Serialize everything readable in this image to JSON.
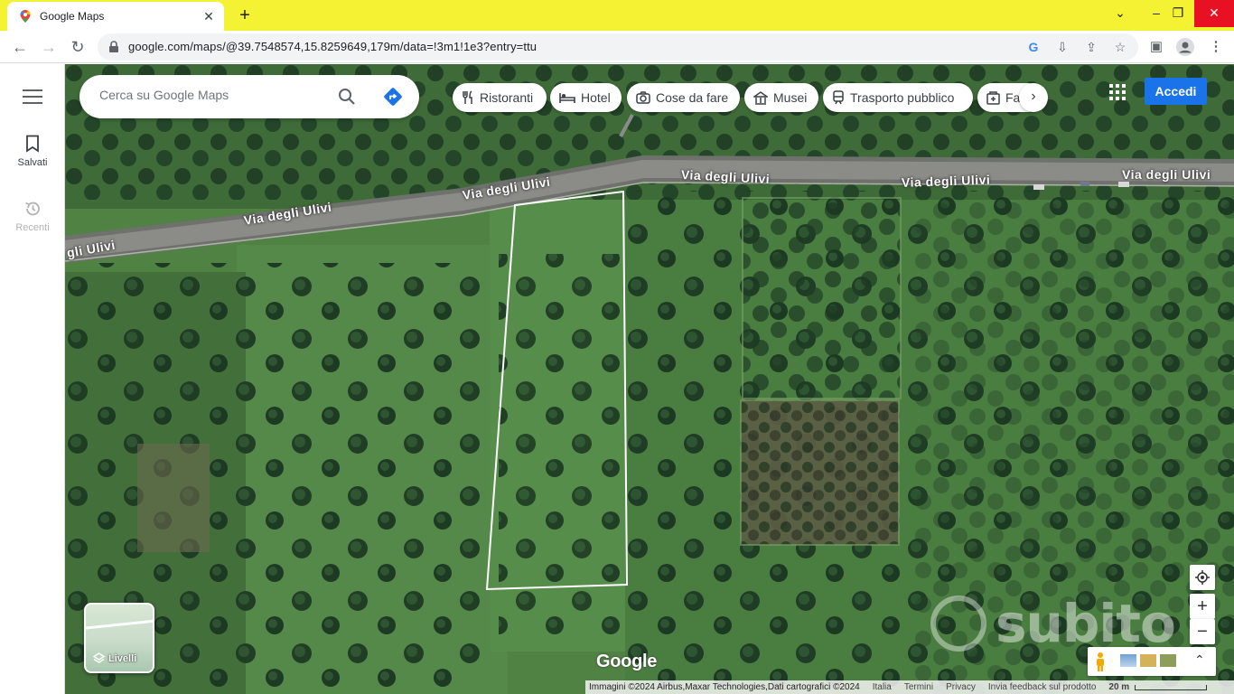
{
  "browser": {
    "tab_title": "Google Maps",
    "url": "google.com/maps/@39.7548574,15.8259649,179m/data=!3m1!1e3?entry=ttu"
  },
  "rail": {
    "saved_label": "Salvati",
    "recent_label": "Recenti"
  },
  "search": {
    "placeholder": "Cerca su Google Maps"
  },
  "chips": [
    {
      "label": "Ristoranti",
      "icon": "fork-knife-icon"
    },
    {
      "label": "Hotel",
      "icon": "bed-icon"
    },
    {
      "label": "Cose da fare",
      "icon": "camera-icon"
    },
    {
      "label": "Musei",
      "icon": "museum-icon"
    },
    {
      "label": "Trasporto pubblico",
      "icon": "train-icon"
    },
    {
      "label": "Fa",
      "icon": "pharmacy-icon"
    }
  ],
  "header": {
    "signin_label": "Accedi"
  },
  "map": {
    "road_labels": [
      "Via degli Ulivi",
      "Via degli Ulivi",
      "Via degli Ulivi",
      "Via degli Ulivi",
      "Via degli Ulivi"
    ],
    "road_label_partial": "gli Ulivi",
    "layers_label": "Livelli",
    "logo_text": "Google",
    "watermark_text": "subito",
    "zoom_in": "+",
    "zoom_out": "−"
  },
  "attribution": {
    "imagery": "Immagini ©2024 Airbus,Maxar Technologies,Dati cartografici ©2024",
    "country": "Italia",
    "terms": "Termini",
    "privacy": "Privacy",
    "feedback": "Invia feedback sul prodotto",
    "scale": "20 m"
  },
  "colors": {
    "accent": "#1a73e8",
    "tabbar": "#f5f233",
    "close": "#e81123"
  }
}
